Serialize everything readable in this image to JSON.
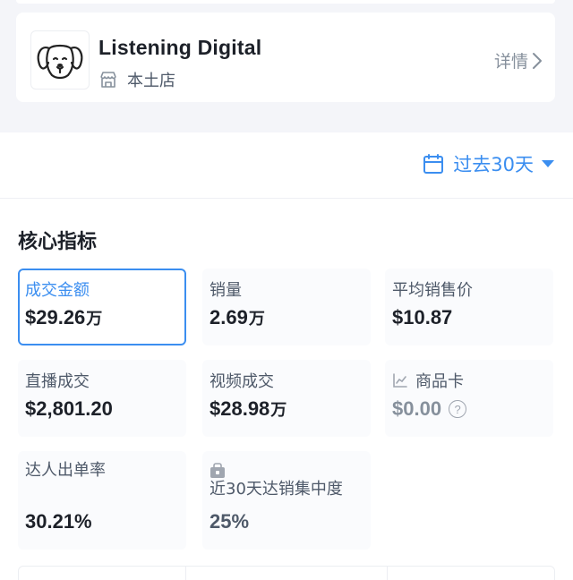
{
  "shop": {
    "name": "Listening Digital",
    "store_type": "本土店",
    "detail_link": "详情",
    "logo_icon": "dog-logo-icon",
    "store_icon": "shop-icon"
  },
  "filter": {
    "date_range": "过去30天",
    "calendar_icon": "calendar-icon",
    "caret_icon": "caret-down-icon"
  },
  "core": {
    "title": "核心指标",
    "metrics": [
      {
        "label": "成交金额",
        "value": "$29.26",
        "unit": "万",
        "active": true
      },
      {
        "label": "销量",
        "value": "2.69",
        "unit": "万"
      },
      {
        "label": "平均销售价",
        "value": "$10.87",
        "unit": ""
      },
      {
        "label": "直播成交",
        "value": "$2,801.20",
        "unit": ""
      },
      {
        "label": "视频成交",
        "value": "$28.98",
        "unit": "万"
      },
      {
        "label": "商品卡",
        "value": "$0.00",
        "unit": "",
        "icon": "chart-icon",
        "help": "?"
      },
      {
        "label": "达人出单率",
        "value": "30.21%",
        "unit": ""
      },
      {
        "label": "近30天达销集中度",
        "value": "25%",
        "unit": "",
        "icon": "lock-box-icon"
      }
    ]
  },
  "colors": {
    "accent": "#3b8ef0",
    "text": "#1d2129",
    "muted": "#86909c",
    "background": "#f4f5f9"
  }
}
